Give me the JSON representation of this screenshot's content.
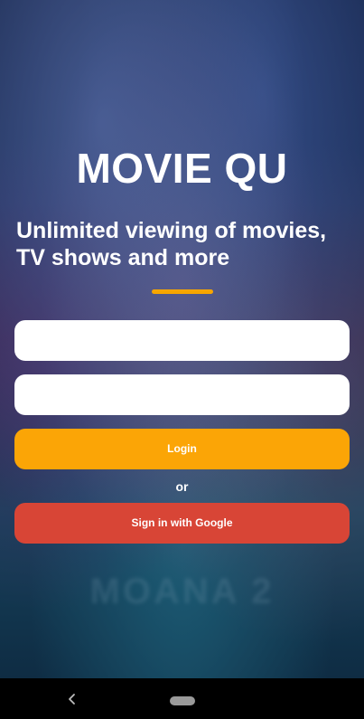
{
  "app": {
    "title": "MOVIE QU",
    "tagline": "Unlimited viewing of movies, TV shows and more",
    "accent_color": "#f7a600"
  },
  "background": {
    "watermark_text": "MOANA 2"
  },
  "form": {
    "username": {
      "value": "",
      "placeholder": ""
    },
    "password": {
      "value": "",
      "placeholder": ""
    },
    "login_label": "Login",
    "login_color": "#fba506",
    "or_label": "or",
    "google_label": "Sign in with Google",
    "google_color": "#d84536"
  },
  "system_nav": {
    "back_icon": "chevron-left-icon",
    "home_icon": "home-pill-icon"
  }
}
